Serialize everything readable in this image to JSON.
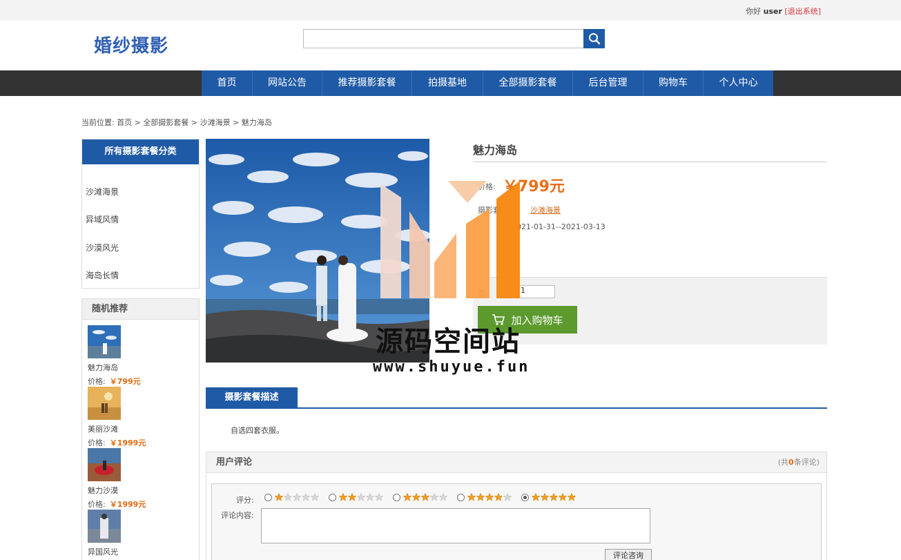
{
  "topbar": {
    "greeting": "你好",
    "username": "user",
    "logout": "[退出系统]"
  },
  "header": {
    "logo": "婚纱摄影",
    "search_placeholder": ""
  },
  "nav": [
    "首页",
    "网站公告",
    "推荐摄影套餐",
    "拍摄基地",
    "全部摄影套餐",
    "后台管理",
    "购物车",
    "个人中心"
  ],
  "breadcrumb": "当前位置: 首页 > 全部摄影套餐 > 沙滩海景 > 魅力海岛",
  "sidebar": {
    "categories_title": "所有摄影套餐分类",
    "categories": [
      "沙滩海景",
      "异域风情",
      "沙漠风光",
      "海岛长情"
    ],
    "recommend_title": "随机推荐",
    "recommend": [
      {
        "name": "魅力海岛",
        "price_label": "价格:",
        "price": "￥799元"
      },
      {
        "name": "美丽沙滩",
        "price_label": "价格:",
        "price": "￥1999元"
      },
      {
        "name": "魅力沙漠",
        "price_label": "价格:",
        "price": "￥1999元"
      },
      {
        "name": "异国风光",
        "price_label": "价格:",
        "price": ""
      }
    ]
  },
  "product": {
    "title": "魅力海岛",
    "price_label": "价格:",
    "price": "￥799元",
    "category_label": "摄影套",
    "category": "沙滩海景",
    "date_label": "",
    "date": "021-01-31--2021-03-13",
    "views_label": "",
    "remain_label": "",
    "qty_label": "数",
    "qty": "1",
    "cart_button": "加入购物车"
  },
  "watermark": {
    "text": "源码空间站",
    "url": "www.shuyue.fun"
  },
  "description": {
    "tab": "摄影套餐描述",
    "text": "自选四套衣服。"
  },
  "reviews": {
    "title": "用户评论",
    "count_prefix": "(共",
    "count": "0",
    "count_suffix": "条评论)",
    "rating_label": "评分:",
    "rating_selected": 5,
    "content_label": "评论内容:",
    "submit": "评论咨询"
  },
  "colors": {
    "primary": "#1f5aa6",
    "accent": "#ea6f1a",
    "cart": "#5c9a2e",
    "nav_bg": "#333333"
  }
}
